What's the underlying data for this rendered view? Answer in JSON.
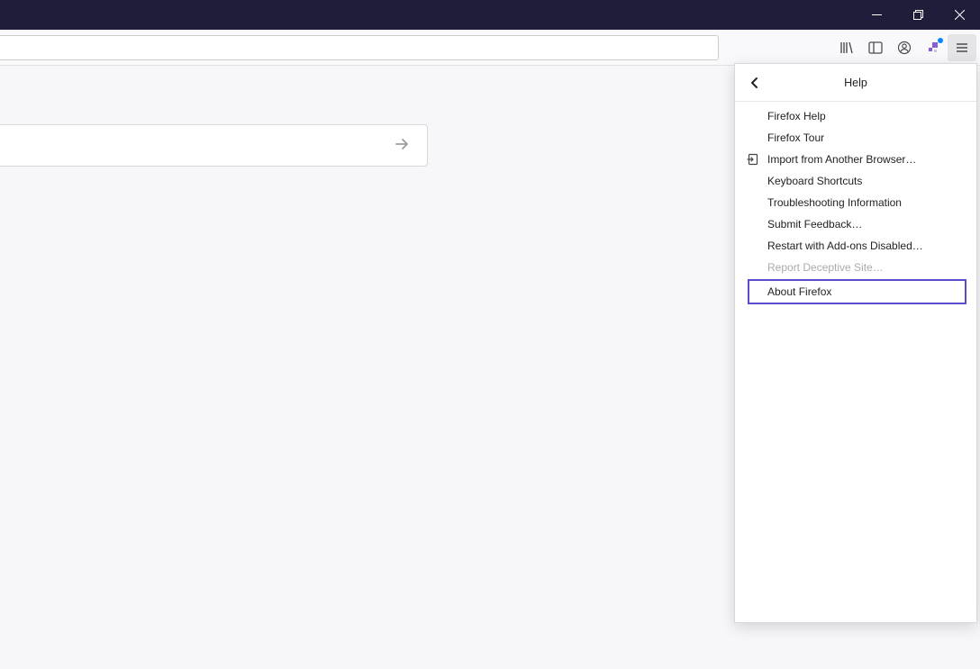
{
  "window": {
    "titlebar_color": "#1e1e3a"
  },
  "menu": {
    "title": "Help",
    "items": [
      {
        "label": "Firefox Help",
        "icon": null,
        "disabled": false,
        "highlighted": false
      },
      {
        "label": "Firefox Tour",
        "icon": null,
        "disabled": false,
        "highlighted": false
      },
      {
        "label": "Import from Another Browser…",
        "icon": "import-icon",
        "disabled": false,
        "highlighted": false
      },
      {
        "label": "Keyboard Shortcuts",
        "icon": null,
        "disabled": false,
        "highlighted": false
      },
      {
        "label": "Troubleshooting Information",
        "icon": null,
        "disabled": false,
        "highlighted": false
      },
      {
        "label": "Submit Feedback…",
        "icon": null,
        "disabled": false,
        "highlighted": false
      },
      {
        "label": "Restart with Add-ons Disabled…",
        "icon": null,
        "disabled": false,
        "highlighted": false
      },
      {
        "label": "Report Deceptive Site…",
        "icon": null,
        "disabled": true,
        "highlighted": false
      },
      {
        "label": "About Firefox",
        "icon": null,
        "disabled": false,
        "highlighted": true
      }
    ]
  }
}
